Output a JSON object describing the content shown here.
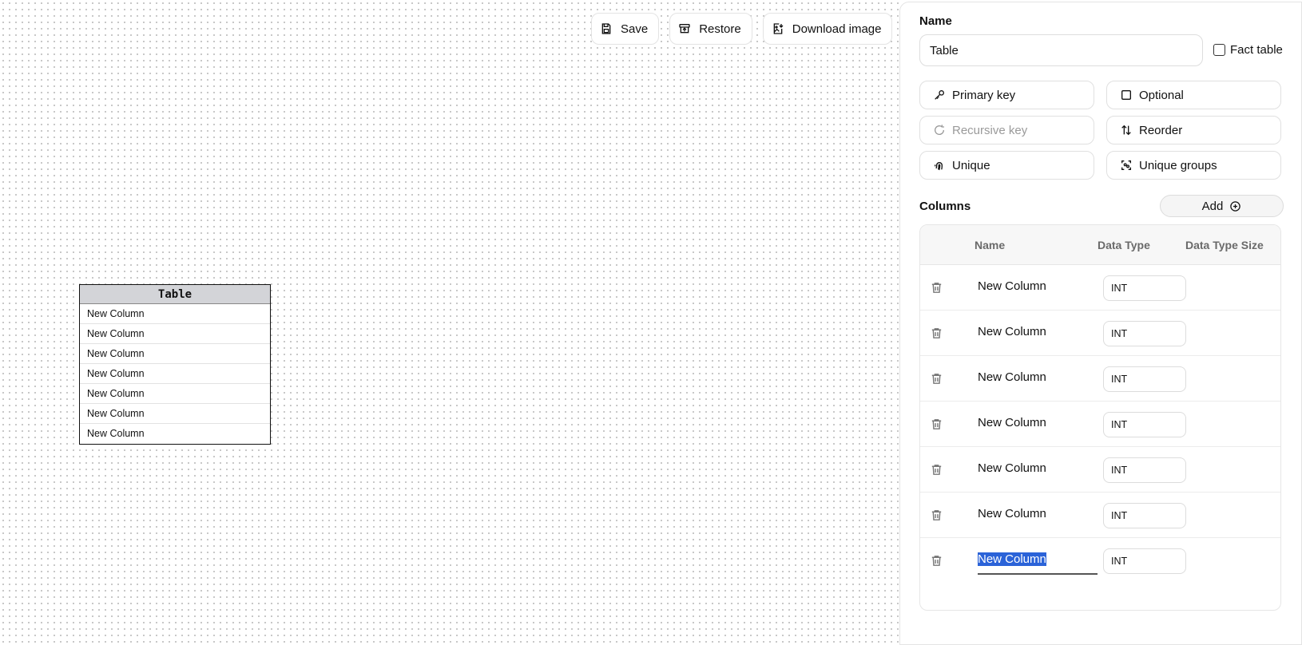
{
  "toolbar": {
    "save": "Save",
    "restore": "Restore",
    "download": "Download image"
  },
  "diagram": {
    "table_title": "Table",
    "rows": [
      "New Column",
      "New Column",
      "New Column",
      "New Column",
      "New Column",
      "New Column",
      "New Column"
    ]
  },
  "panel": {
    "name_label": "Name",
    "name_value": "Table",
    "fact_table": "Fact table",
    "buttons": {
      "primary_key": "Primary key",
      "optional": "Optional",
      "recursive_key": "Recursive key",
      "reorder": "Reorder",
      "unique": "Unique",
      "unique_groups": "Unique groups"
    },
    "columns_label": "Columns",
    "add": "Add",
    "headers": {
      "name": "Name",
      "data_type": "Data Type",
      "data_type_size": "Data Type Size"
    },
    "columns": [
      {
        "name": "New Column",
        "type": "INT"
      },
      {
        "name": "New Column",
        "type": "INT"
      },
      {
        "name": "New Column",
        "type": "INT"
      },
      {
        "name": "New Column",
        "type": "INT"
      },
      {
        "name": "New Column",
        "type": "INT"
      },
      {
        "name": "New Column",
        "type": "INT"
      },
      {
        "name": "New Column",
        "type": "INT"
      }
    ]
  }
}
